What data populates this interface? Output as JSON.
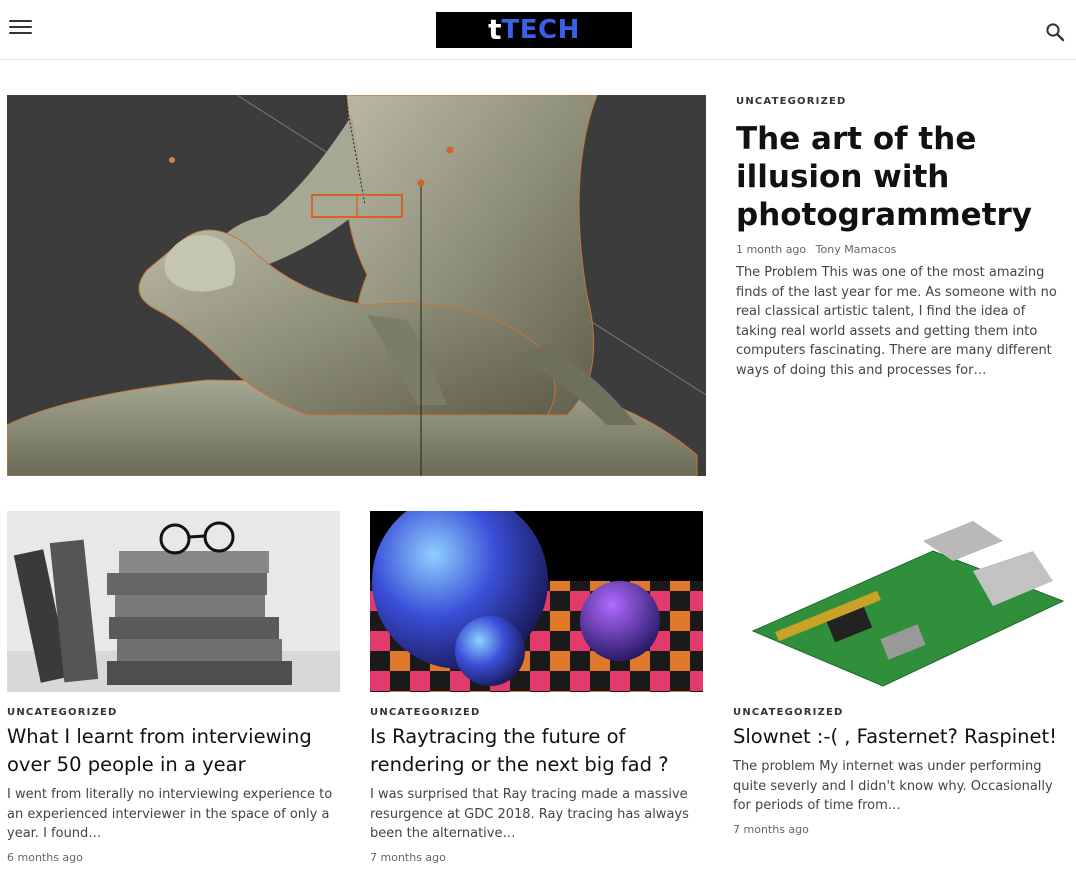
{
  "header": {
    "logo_first": "t",
    "logo_rest": "TECH",
    "menu_icon": "hamburger-menu-icon",
    "search_icon": "search-icon"
  },
  "colors": {
    "logo_background": "#000000",
    "logo_accent": "#3a5fe8",
    "text_primary": "#111111",
    "text_secondary": "#444444",
    "meta": "#666666"
  },
  "featured": {
    "category": "UNCATEGORIZED",
    "title": "The art of the illusion with photogrammetry",
    "time": "1 month ago",
    "author": "Tony Mamacos",
    "excerpt": "The Problem This was one of the most amazing finds of the last year for me. As someone with no real classical artistic talent, I find the idea of taking real world assets and getting them into computers fascinating. There are many different ways of doing this and processes for…"
  },
  "posts": [
    {
      "category": "UNCATEGORIZED",
      "title": "What I learnt from interviewing over 50 people in a year",
      "excerpt": "I went from literally no interviewing experience to an experienced interviewer in the space of only a year. I found…",
      "time": "6 months ago"
    },
    {
      "category": "UNCATEGORIZED",
      "title": "Is Raytracing the future of rendering or the next big fad ?",
      "excerpt": "I was surprised that Ray tracing made a massive resurgence at GDC 2018. Ray tracing has always been the alternative…",
      "time": "7 months ago"
    },
    {
      "category": "UNCATEGORIZED",
      "title": "Slownet :-( , Fasternet? Raspinet!",
      "excerpt": "The problem My internet was under performing quite severly and I didn't know why. Occasionally for periods of time from…",
      "time": "7 months ago"
    }
  ]
}
